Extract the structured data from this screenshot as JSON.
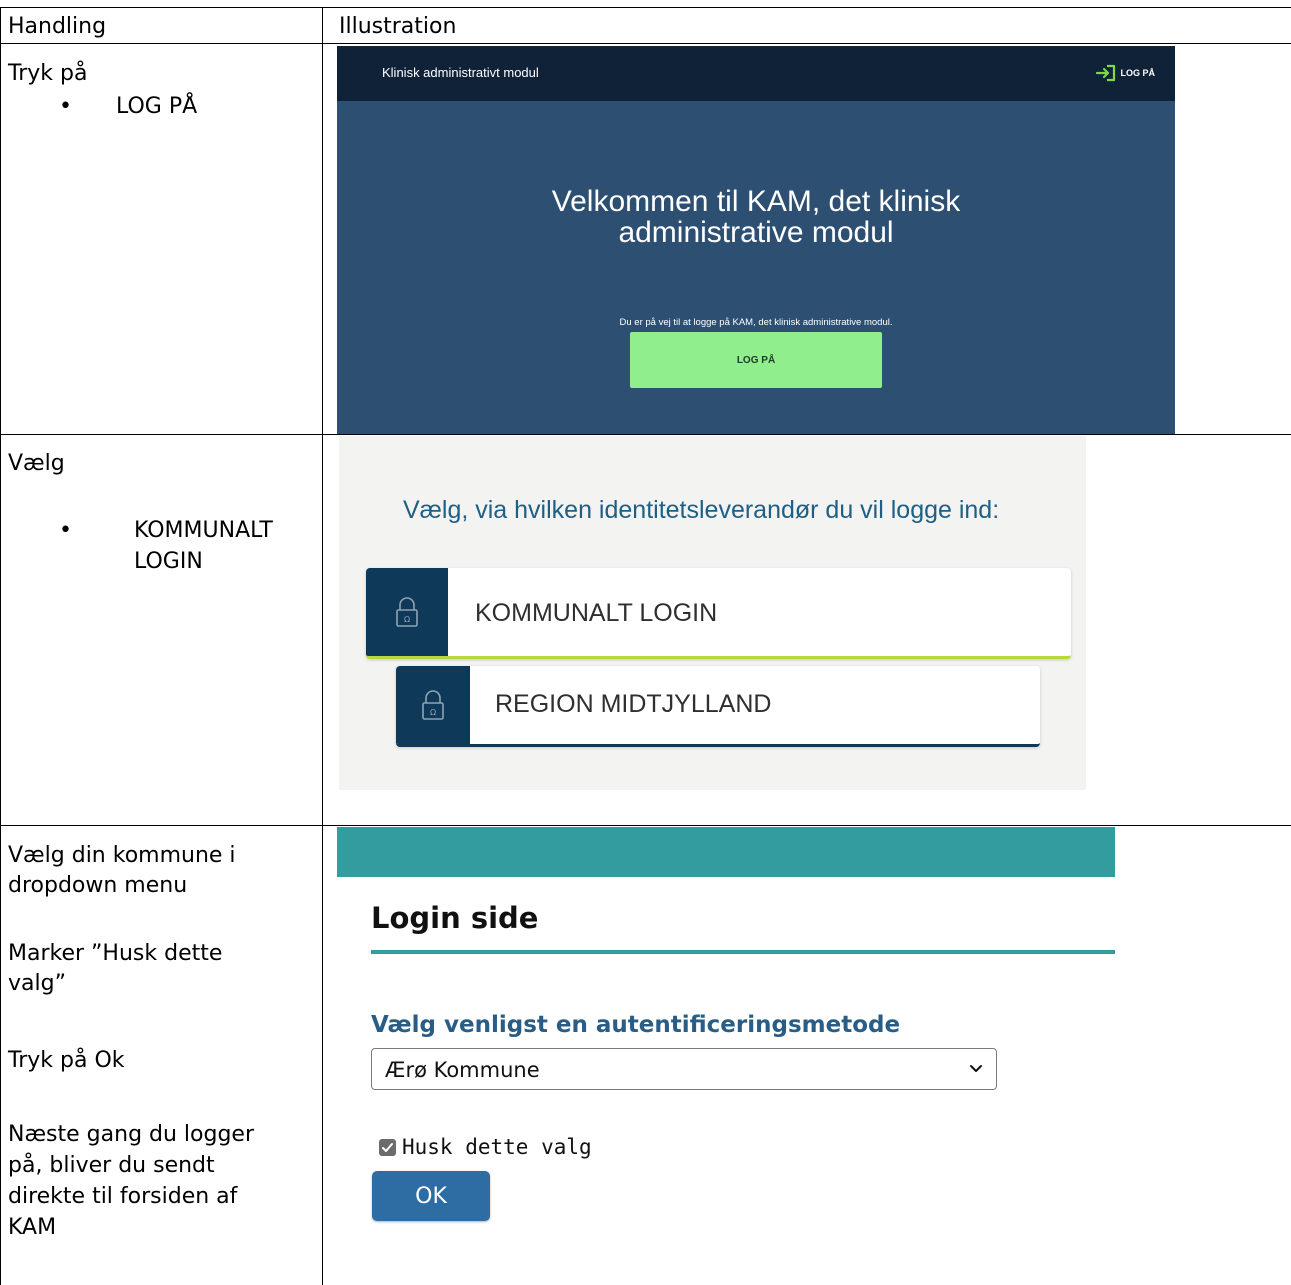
{
  "table": {
    "headers": [
      "Handling",
      "Illustration"
    ],
    "rows": [
      {
        "action_intro": "Tryk på",
        "action_bullet": "LOG PÅ"
      },
      {
        "action_intro": "Vælg",
        "action_bullet_line1": "KOMMUNALT",
        "action_bullet_line2": "LOGIN"
      },
      {
        "step1_line1": "Vælg din kommune i",
        "step1_line2": "dropdown menu",
        "step2_line1": "Marker ”Husk dette",
        "step2_line2": "valg”",
        "step3": "Tryk på Ok",
        "step4_line1": "Næste gang du logger",
        "step4_line2": "på, bliver du sendt",
        "step4_line3": "direkte til forsiden af",
        "step4_line4": "KAM"
      }
    ]
  },
  "kam_screen": {
    "app_title": "Klinisk administrativt modul",
    "nav_login": "LOG PÅ",
    "welcome_line1": "Velkommen til KAM, det klinisk",
    "welcome_line2": "administrative modul",
    "subtext": "Du er på vej til at logge på KAM, det klinisk administrative modul.",
    "login_button": "LOG PÅ",
    "colors": {
      "topbar": "#0f2237",
      "background": "#2c4f72",
      "button": "#90ee8c"
    }
  },
  "idp_screen": {
    "heading": "Vælg, via hvilken identitetsleverandør du vil logge ind:",
    "options": [
      {
        "label": "KOMMUNALT LOGIN",
        "icon": "lock-icon",
        "accent": "#b9d93a"
      },
      {
        "label": "REGION MIDTJYLLAND",
        "icon": "lock-icon",
        "accent": "#0f3958"
      }
    ]
  },
  "login_page": {
    "title": "Login side",
    "method_label": "Vælg venligst en autentificeringsmetode",
    "selected_municipality": "Ærø Kommune",
    "remember_label": "Husk dette valg",
    "remember_checked": true,
    "ok_button": "OK",
    "colors": {
      "accent": "#339c9e",
      "button": "#2e6da4"
    }
  }
}
